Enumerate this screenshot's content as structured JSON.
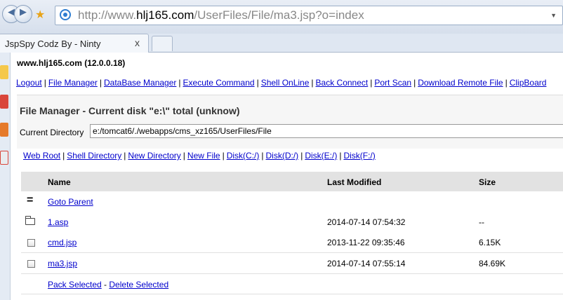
{
  "browser": {
    "url_prefix": "http://www.",
    "url_host": "hlj165.com",
    "url_rest": "/UserFiles/File/ma3.jsp?o=index",
    "tab_title": "JspSpy Codz By - Ninty",
    "tab_close": "x"
  },
  "page": {
    "host_line": "www.hlj165.com (12.0.0.18)",
    "menu": [
      "Logout",
      "File Manager",
      "DataBase Manager",
      "Execute Command",
      "Shell OnLine",
      "Back Connect",
      "Port Scan",
      "Download Remote File",
      "ClipBoard"
    ],
    "title": "File Manager - Current disk \"e:\\\" total (unknow)",
    "current_dir_label": "Current Directory",
    "current_dir_value": "e:/tomcat6/./webapps/cms_xz165/UserFiles/File",
    "quick_links": [
      "Web Root",
      "Shell Directory",
      "New Directory",
      "New File",
      "Disk(C:/)",
      "Disk(D:/)",
      "Disk(E:/)",
      "Disk(F:/)"
    ],
    "table": {
      "headers": {
        "name": "Name",
        "modified": "Last Modified",
        "size": "Size"
      },
      "parent_icon": "=",
      "parent_label": "Goto Parent",
      "rows": [
        {
          "name": "1.asp",
          "modified": "2014-07-14 07:54:32",
          "size": "--"
        },
        {
          "name": "cmd.jsp",
          "modified": "2013-11-22 09:35:46",
          "size": "6.15K"
        },
        {
          "name": "ma3.jsp",
          "modified": "2014-07-14 07:55:14",
          "size": "84.69K"
        }
      ]
    },
    "pack_selected": "Pack Selected",
    "action_sep": " - ",
    "delete_selected": "Delete Selected"
  },
  "icons": {
    "back": "back-arrow-icon",
    "forward": "forward-arrow-icon",
    "favorites": "star-icon",
    "site": "ie-icon"
  }
}
